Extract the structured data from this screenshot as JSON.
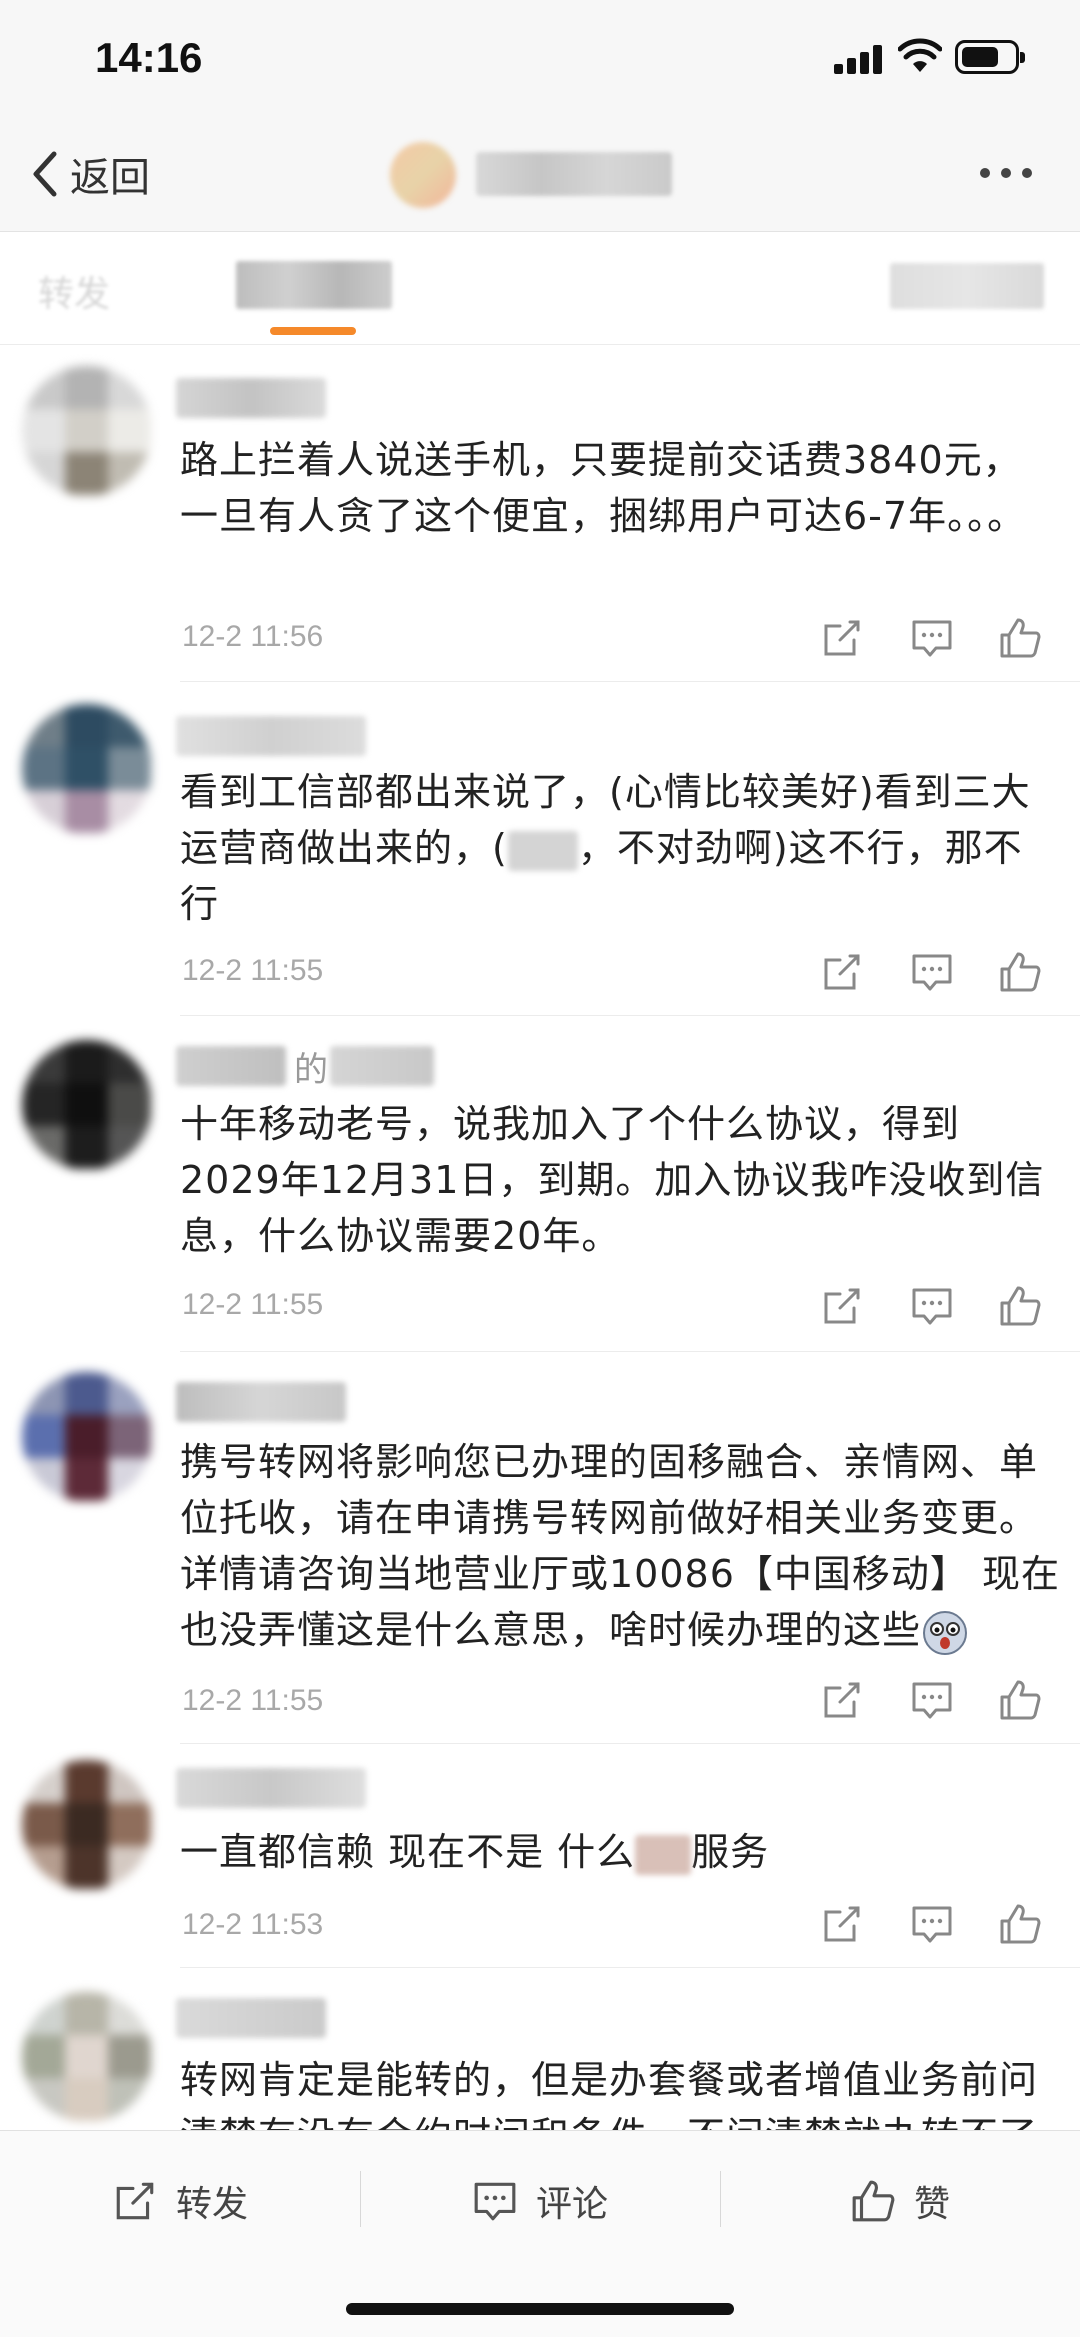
{
  "status_bar": {
    "time": "14:16",
    "battery_level": 0.7
  },
  "nav": {
    "back_label": "返回"
  },
  "tabs": {
    "repost_label": "转发"
  },
  "comments": [
    {
      "text": "路上拦着人说送手机，只要提前交话费3840元，一旦有人贪了这个便宜，捆绑用户可达6-7年。。。",
      "time": "12-2 11:56"
    },
    {
      "text_a": "看到工信部都出来说了，(心情比较美好)看到三大运营商做出来的，(",
      "text_b": "，不对劲啊)这不行，那不行",
      "time": "12-2 11:55"
    },
    {
      "name_visible": "的",
      "text": "十年移动老号，说我加入了个什么协议，得到2029年12月31日，到期。加入协议我咋没收到信息，什么协议需要20年。",
      "time": "12-2 11:55"
    },
    {
      "text": "携号转网将影响您已办理的固移融合、亲情网、单位托收，请在申请携号转网前做好相关业务变更。详情请咨询当地营业厅或10086【中国移动】 现在也没弄懂这是什么意思，啥时候办理的这些",
      "time": "12-2 11:55"
    },
    {
      "text_a": "一直都信赖  现在不是  什么",
      "text_b": "服务",
      "time": "12-2 11:53"
    },
    {
      "text": "转网肯定是能转的，但是办套餐或者增值业务前问清楚有没有合约时间和条件，不问清楚就办转不了"
    }
  ],
  "bottom_bar": {
    "repost_label": "转发",
    "comment_label": "评论",
    "like_label": "赞"
  },
  "colors": {
    "accent": "#f5892a",
    "timestamp": "#a8a8a8"
  }
}
